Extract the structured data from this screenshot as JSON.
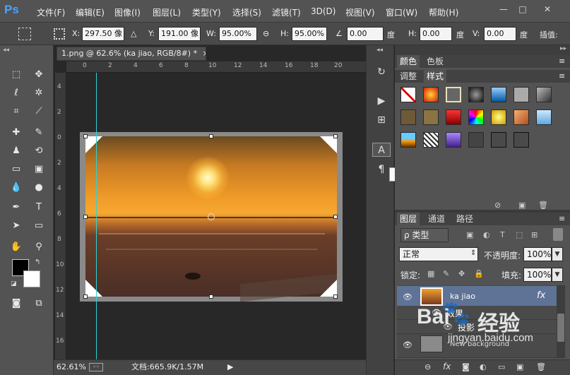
{
  "menubar": {
    "logo": "Ps",
    "items": [
      "文件(F)",
      "编辑(E)",
      "图像(I)",
      "图层(L)",
      "类型(Y)",
      "选择(S)",
      "滤镜(T)",
      "3D(D)",
      "视图(V)",
      "窗口(W)",
      "帮助(H)"
    ],
    "win_min": "—",
    "win_max": "□",
    "win_close": "✕"
  },
  "options": {
    "x_label": "X:",
    "x_value": "297.50 像",
    "y_label": "Y:",
    "y_value": "191.00 像",
    "w_label": "W:",
    "w_value": "95.00%",
    "h_label": "H:",
    "h_value": "95.00%",
    "angle_value": "0.00",
    "angle_unit": "度",
    "hskew_label": "H:",
    "hskew_value": "0.00",
    "hskew_unit": "度",
    "vskew_label": "V:",
    "vskew_value": "0.00",
    "vskew_unit": "度",
    "interp_label": "插值:"
  },
  "document": {
    "tab_title": "1.png @ 62.6% (ka jiao, RGB/8#) *",
    "tab_close": "×",
    "zoom": "62.61%",
    "doc_info": "文档:665.9K/1.57M",
    "ruler_top": [
      "0",
      "2",
      "4",
      "6",
      "8",
      "10",
      "12",
      "14",
      "16",
      "18",
      "20"
    ],
    "ruler_left": [
      "4",
      "2",
      "0",
      "2",
      "4",
      "6",
      "8",
      "10",
      "12",
      "14",
      "16"
    ]
  },
  "tooltip": "字符",
  "panels": {
    "top_tabs": [
      "颜色",
      "色板"
    ],
    "style_tabs": [
      "调整",
      "样式"
    ],
    "layer_tabs": [
      "图层",
      "通道",
      "路径"
    ],
    "filter_kind": "ρ 类型",
    "blend_mode": "正常",
    "opacity_label": "不透明度:",
    "opacity_value": "100%",
    "lock_label": "锁定:",
    "fill_label": "填充:",
    "fill_value": "100%"
  },
  "layers": [
    {
      "name": "ka jiao",
      "fx": "fx"
    },
    {
      "name": "效果"
    },
    {
      "name": "投影"
    },
    {
      "name": "New background"
    }
  ],
  "watermark": {
    "brand": "Bai",
    "brand2": "经验",
    "url": "jingyan.baidu.com"
  }
}
